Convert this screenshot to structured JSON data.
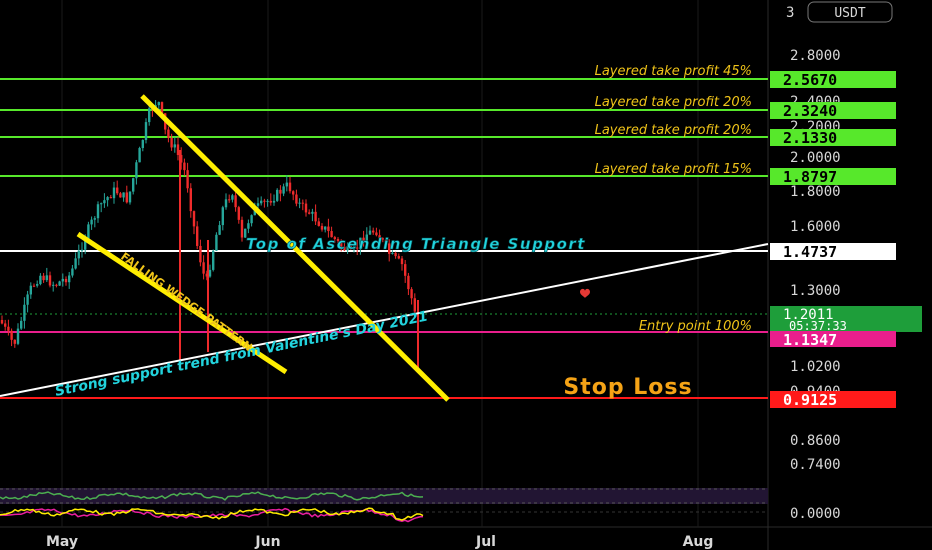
{
  "chart_data": {
    "type": "candlestick",
    "symbol_unit": "USDT",
    "y_axis": {
      "scale": "log",
      "tick_labels": [
        "3",
        "2.8000",
        "2.4000",
        "2.2000",
        "2.0000",
        "1.8000",
        "1.6000",
        "1.3000",
        "1.0200",
        "0.9400",
        "0.8600",
        "0.7400"
      ]
    },
    "x_axis": {
      "tick_labels": [
        "May",
        "Jun",
        "Jul",
        "Aug"
      ]
    },
    "price_lines": [
      {
        "value": 2.567,
        "label": "2.5670",
        "note": "Layered take profit 45%",
        "color": "#57e82b"
      },
      {
        "value": 2.324,
        "label": "2.3240",
        "note": "Layered take profit 20%",
        "color": "#57e82b"
      },
      {
        "value": 2.133,
        "label": "2.1330",
        "note": "Layered take profit 20%",
        "color": "#57e82b"
      },
      {
        "value": 1.8797,
        "label": "1.8797",
        "note": "Layered take profit 15%",
        "color": "#57e82b"
      },
      {
        "value": 1.4737,
        "label": "1.4737",
        "note": "",
        "color": "#ffffff"
      },
      {
        "value": 1.1347,
        "label": "1.1347",
        "note": "Entry point 100%",
        "color": "#e91e8c"
      },
      {
        "value": 0.9125,
        "label": "0.9125",
        "note": "",
        "color": "#ff1a1a"
      }
    ],
    "last_price": {
      "value": 1.2011,
      "label": "1.2011",
      "countdown": "05:37:33",
      "color": "#1e9e3a"
    },
    "annotations": {
      "stop_loss": "Stop Loss",
      "ascending_triangle": "Top of Ascending Triangle Support",
      "support_trend": "Strong support trend from Valentine's Day 2021",
      "falling_wedge": "FALLING WEDGE PATTERN"
    },
    "oscillator": {
      "tick_label": "0.0000"
    },
    "colors": {
      "up_candle": "#26a69a",
      "down_candle": "#ef2b2b",
      "wedge_lines": "#ffee00",
      "annotation_gold": "#f0c419",
      "annotation_cyan": "#22d3dd"
    }
  }
}
